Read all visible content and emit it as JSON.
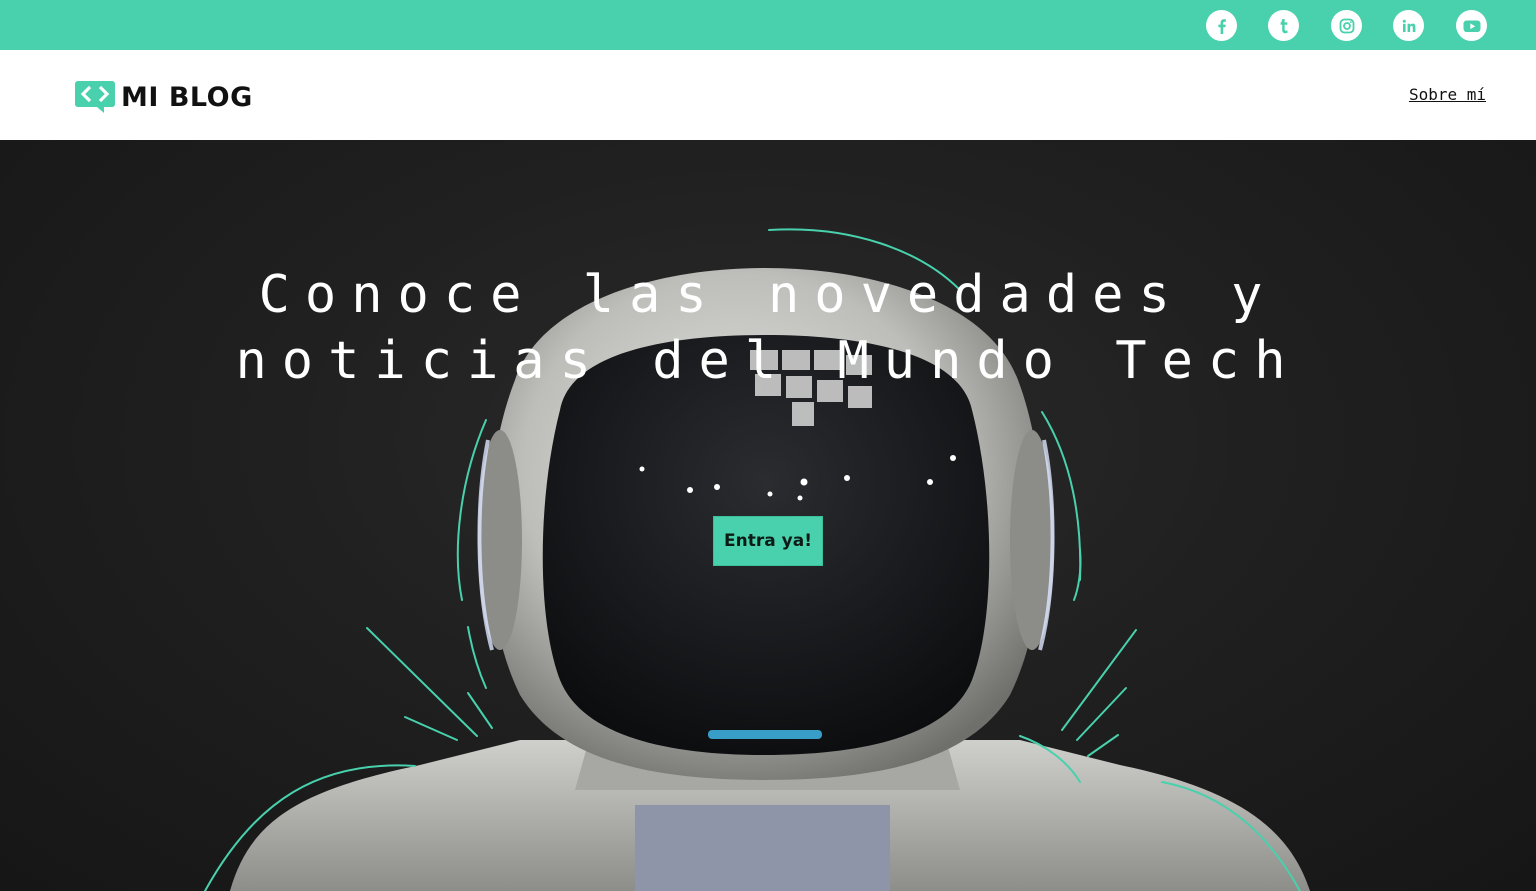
{
  "colors": {
    "accent": "#48d1ac",
    "header_bg": "#ffffff",
    "hero_bg": "#1e1e1e",
    "text_dark": "#111111",
    "text_light": "#ffffff"
  },
  "topbar": {
    "social": [
      {
        "name": "facebook",
        "icon": "facebook-icon"
      },
      {
        "name": "tumblr",
        "icon": "tumblr-icon"
      },
      {
        "name": "instagram",
        "icon": "instagram-icon"
      },
      {
        "name": "linkedin",
        "icon": "linkedin-icon"
      },
      {
        "name": "youtube",
        "icon": "youtube-icon"
      }
    ]
  },
  "header": {
    "logo_icon": "code-bubble-icon",
    "logo_text": "MI BLOG",
    "nav_about": "Sobre mí"
  },
  "hero": {
    "title_line1": "Conoce las novedades y",
    "title_line2": "noticias del Mundo Tech",
    "cta_label": "Entra ya!"
  }
}
